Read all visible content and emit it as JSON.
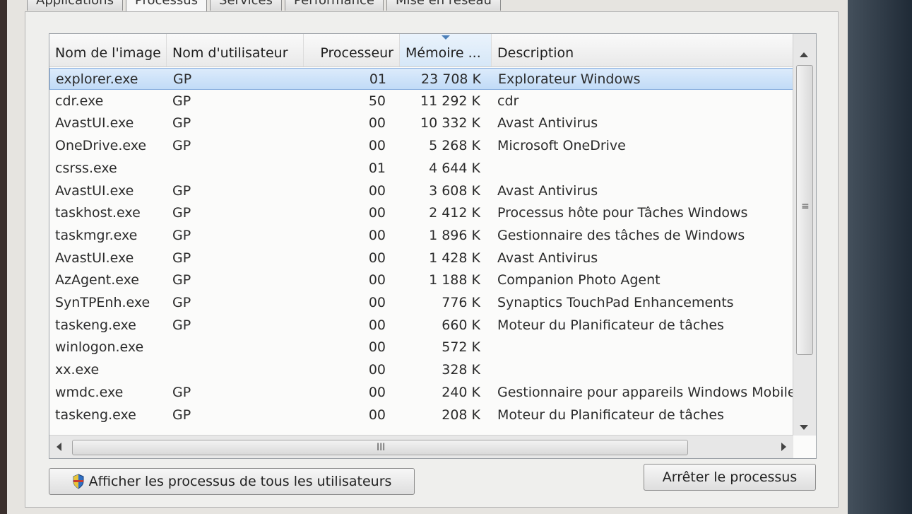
{
  "tabs": [
    {
      "label": "Applications"
    },
    {
      "label": "Processus"
    },
    {
      "label": "Services"
    },
    {
      "label": "Performance"
    },
    {
      "label": "Mise en réseau"
    }
  ],
  "columns": {
    "name": "Nom de l'image",
    "user": "Nom d'utilisateur",
    "cpu": "Processeur",
    "mem": "Mémoire ...",
    "desc": "Description"
  },
  "rows": [
    {
      "name": "explorer.exe",
      "user": "GP",
      "cpu": "01",
      "mem": "23 708 K",
      "desc": "Explorateur Windows"
    },
    {
      "name": "cdr.exe",
      "user": "GP",
      "cpu": "50",
      "mem": "11 292 K",
      "desc": "cdr"
    },
    {
      "name": "AvastUI.exe",
      "user": "GP",
      "cpu": "00",
      "mem": "10 332 K",
      "desc": "Avast Antivirus"
    },
    {
      "name": "OneDrive.exe",
      "user": "GP",
      "cpu": "00",
      "mem": "5 268 K",
      "desc": "Microsoft OneDrive"
    },
    {
      "name": "csrss.exe",
      "user": "",
      "cpu": "01",
      "mem": "4 644 K",
      "desc": ""
    },
    {
      "name": "AvastUI.exe",
      "user": "GP",
      "cpu": "00",
      "mem": "3 608 K",
      "desc": "Avast Antivirus"
    },
    {
      "name": "taskhost.exe",
      "user": "GP",
      "cpu": "00",
      "mem": "2 412 K",
      "desc": "Processus hôte pour Tâches Windows"
    },
    {
      "name": "taskmgr.exe",
      "user": "GP",
      "cpu": "00",
      "mem": "1 896 K",
      "desc": "Gestionnaire des tâches de Windows"
    },
    {
      "name": "AvastUI.exe",
      "user": "GP",
      "cpu": "00",
      "mem": "1 428 K",
      "desc": "Avast Antivirus"
    },
    {
      "name": "AzAgent.exe",
      "user": "GP",
      "cpu": "00",
      "mem": "1 188 K",
      "desc": "Companion Photo Agent"
    },
    {
      "name": "SynTPEnh.exe",
      "user": "GP",
      "cpu": "00",
      "mem": "776 K",
      "desc": "Synaptics TouchPad Enhancements"
    },
    {
      "name": "taskeng.exe",
      "user": "GP",
      "cpu": "00",
      "mem": "660 K",
      "desc": "Moteur du Planificateur de tâches"
    },
    {
      "name": "winlogon.exe",
      "user": "",
      "cpu": "00",
      "mem": "572 K",
      "desc": ""
    },
    {
      "name": "xx.exe",
      "user": "",
      "cpu": "00",
      "mem": "328 K",
      "desc": ""
    },
    {
      "name": "wmdc.exe",
      "user": "GP",
      "cpu": "00",
      "mem": "240 K",
      "desc": "Gestionnaire pour appareils Windows Mobile"
    },
    {
      "name": "taskeng.exe",
      "user": "GP",
      "cpu": "00",
      "mem": "208 K",
      "desc": "Moteur du Planificateur de tâches"
    }
  ],
  "hscroll_grip": "III",
  "buttons": {
    "show_all": "Afficher les processus de tous les utilisateurs",
    "end_process": "Arrêter le processus"
  },
  "colors": {
    "selection": "#c1dbf7",
    "sorted_header": "#d6e7f7"
  }
}
